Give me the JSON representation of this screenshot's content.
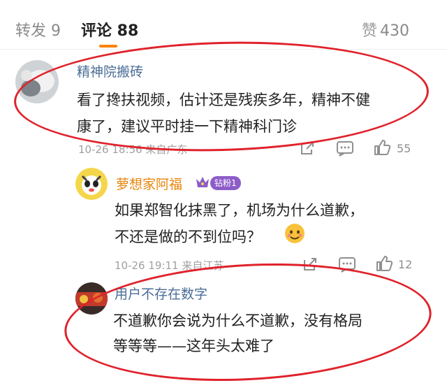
{
  "tabs": {
    "repost": "转发 9",
    "comments": "评论 88",
    "likes_glyph": "赞",
    "likes_count": "430"
  },
  "comments": [
    {
      "username": "精神院搬砖",
      "text_line1": "看了搀扶视频，估计还是残疾多年，精神不健",
      "text_line2": "康了，建议平时挂一下精神科门诊",
      "meta": "10-26 18:56 来自广东",
      "like_count": "55"
    },
    {
      "username": "萝想家阿福",
      "badge": "钻粉1",
      "text_line1": "如果郑智化抹黑了，机场为什么道歉，",
      "text_line2": "不还是做的不到位吗？",
      "meta": "10-26 19:11 来自江苏",
      "like_count": "12"
    },
    {
      "username": "用户不存在数字",
      "text_line1": "不道歉你会说为什么不道歉，没有格局",
      "text_line2": "等等等——这年头太难了"
    }
  ],
  "colors": {
    "accent": "#ff8200",
    "username": "#4a6d96",
    "annotation": "#e0222b"
  },
  "icons": [
    "share-icon",
    "comment-icon",
    "like-icon",
    "emoji-icon",
    "crown-icon"
  ]
}
